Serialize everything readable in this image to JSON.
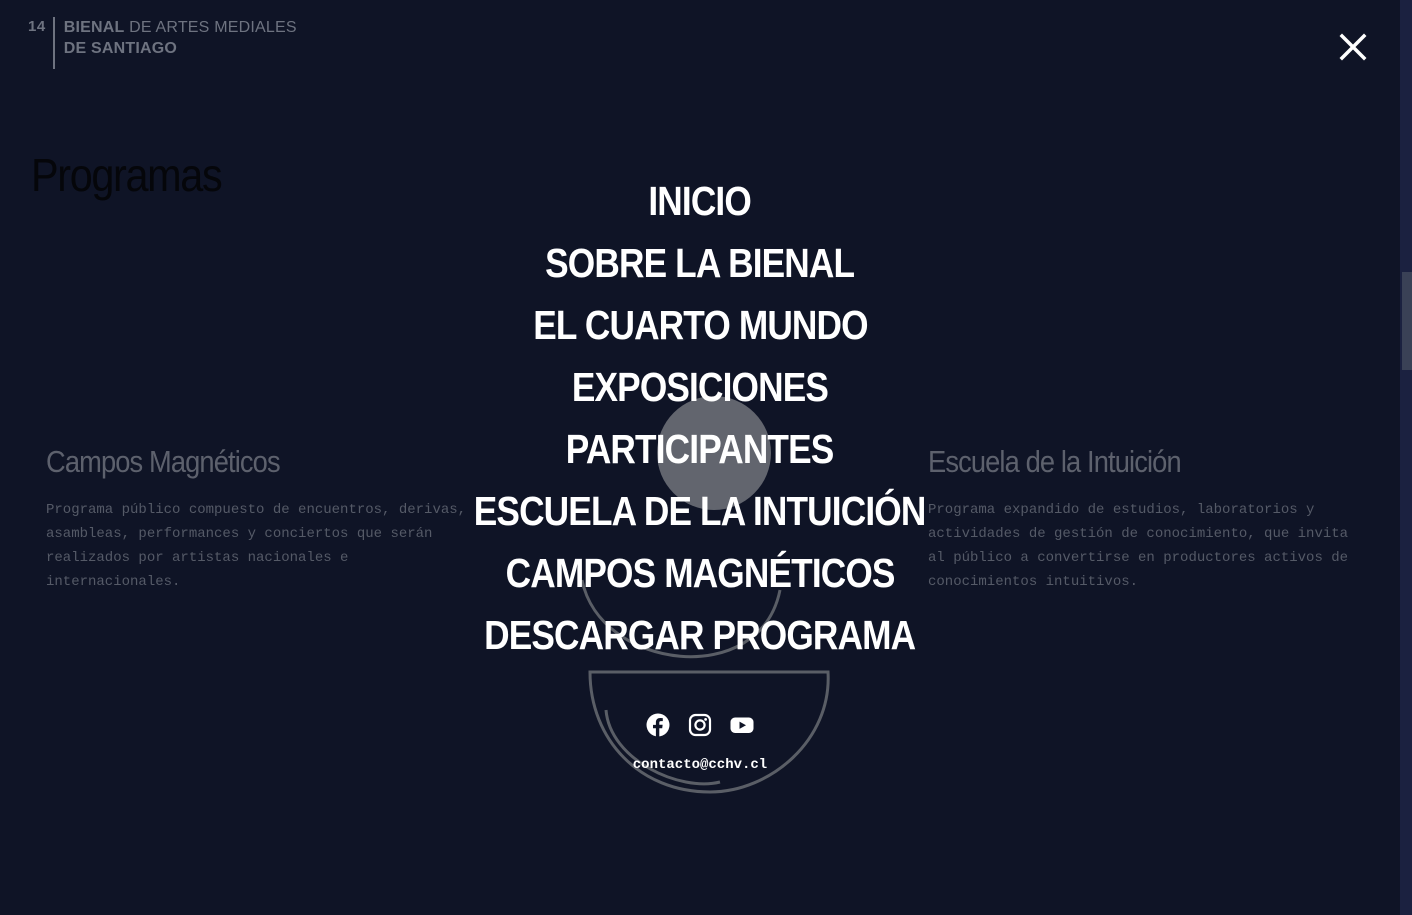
{
  "logo": {
    "number": "14",
    "line1_bold": "BIENAL",
    "line1_rest": "DE ARTES MEDIALES",
    "line2": "DE SANTIAGO"
  },
  "page_title": "Programas",
  "programs": [
    {
      "title": "Campos Magnéticos",
      "description": "Programa público compuesto de encuentros, derivas, asambleas, performances y conciertos que serán realizados por artistas nacionales e internacionales."
    },
    {
      "title": "Escuela de la Intuición",
      "description": "Programa expandido de estudios, laboratorios y actividades de gestión de conocimiento, que invita al público a convertirse en productores activos de conocimientos intuitivos."
    }
  ],
  "menu": {
    "items": [
      "INICIO",
      "SOBRE LA BIENAL",
      "EL CUARTO MUNDO",
      "EXPOSICIONES",
      "PARTICIPANTES",
      "ESCUELA DE LA INTUICIÓN",
      "CAMPOS MAGNÉTICOS",
      "DESCARGAR PROGRAMA"
    ]
  },
  "social": [
    "facebook-icon",
    "instagram-icon",
    "youtube-icon"
  ],
  "contact_email": "contacto@cchv.cl",
  "icons": {
    "close": "close-icon"
  },
  "colors": {
    "background": "#0f1426",
    "menu_text": "#ffffff",
    "dim_text": "#5d616d"
  }
}
